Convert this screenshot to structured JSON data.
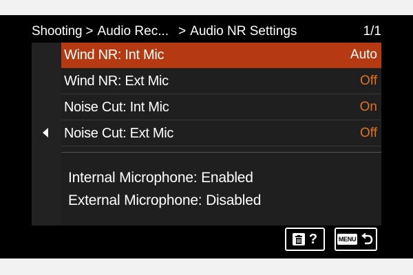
{
  "header": {
    "crumb1": "Shooting",
    "crumb2": "Audio Rec...",
    "current": "Audio NR Settings",
    "page": "1/1"
  },
  "menu": [
    {
      "label": "Wind NR: Int Mic",
      "value": "Auto",
      "selected": true
    },
    {
      "label": "Wind NR: Ext Mic",
      "value": "Off",
      "selected": false
    },
    {
      "label": "Noise Cut: Int Mic",
      "value": "On",
      "selected": false
    },
    {
      "label": "Noise Cut: Ext Mic",
      "value": "Off",
      "selected": false
    }
  ],
  "info": {
    "line1": "Internal Microphone: Enabled",
    "line2": "External Microphone: Disabled"
  },
  "buttons": {
    "help_glyph": "?",
    "menu_label": "MENU",
    "delete_icon": "trash-icon",
    "back_icon": "return-arrow-icon"
  },
  "colors": {
    "selected_row": "#b53a12",
    "value_text": "#e0731f",
    "panel_bg": "#1f1f1f"
  }
}
